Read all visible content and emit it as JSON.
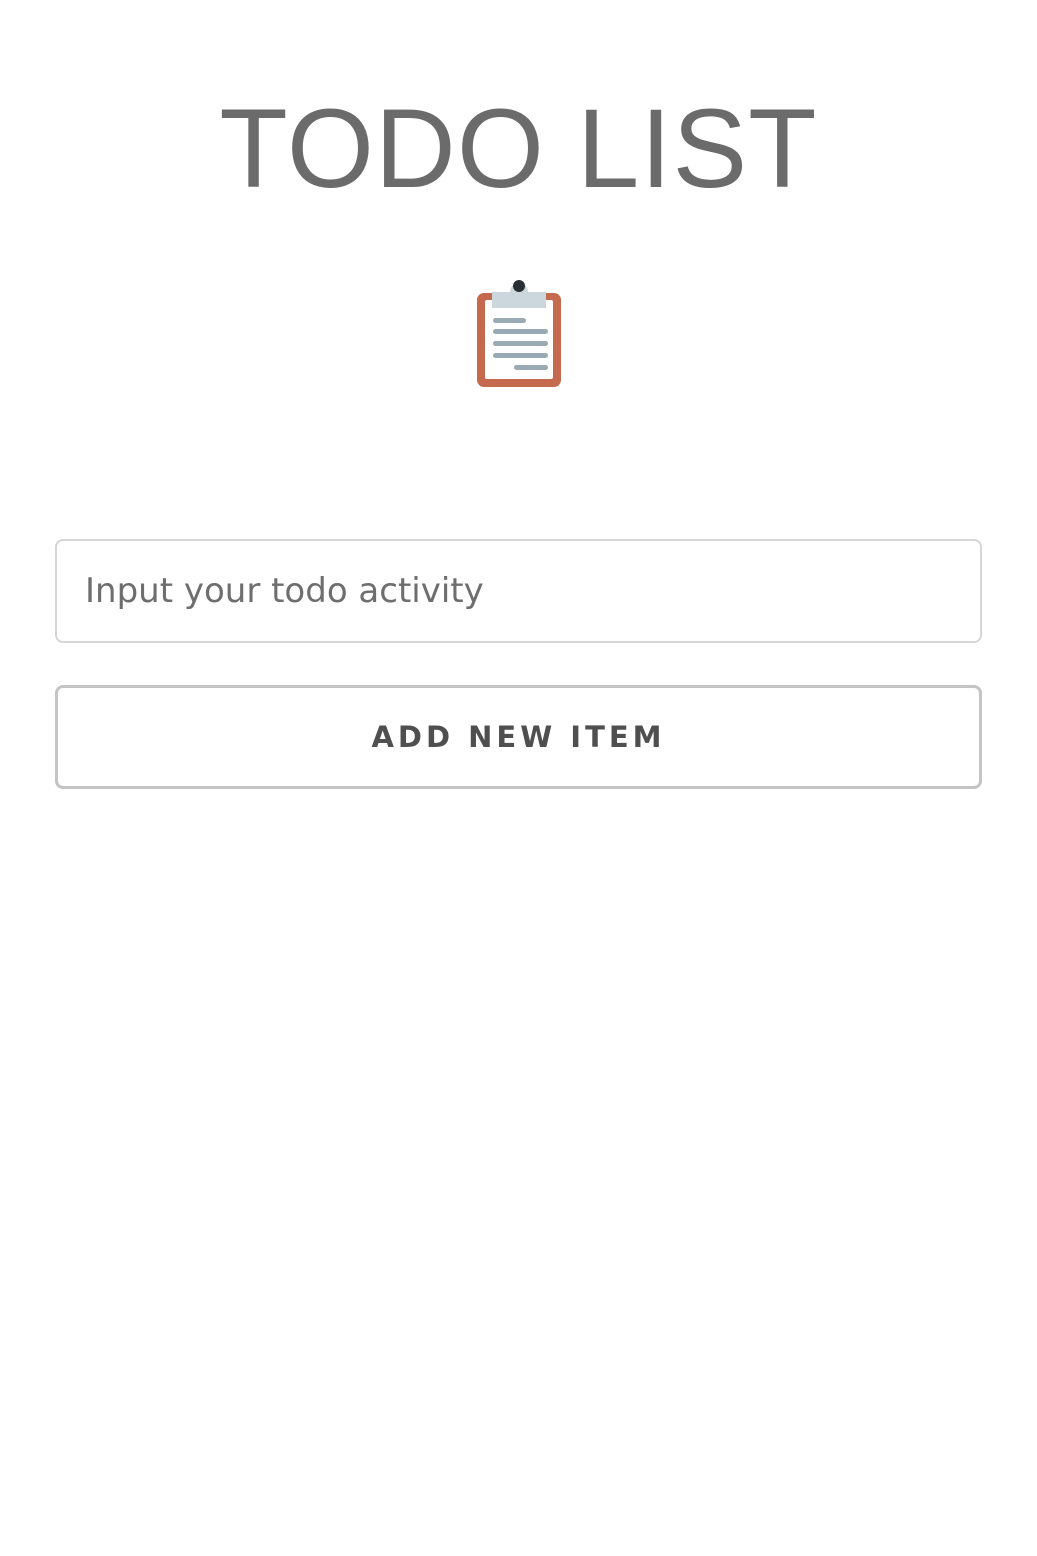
{
  "header": {
    "title": "TODO LIST",
    "icon": "clipboard-icon"
  },
  "form": {
    "input_placeholder": "Input your todo activity",
    "input_value": "",
    "add_button_label": "ADD NEW ITEM"
  },
  "todo_items": [],
  "colors": {
    "title": "#6b6b6b",
    "clipboard_board": "#c5694f",
    "clipboard_clip": "#ccd6dd",
    "clipboard_lines": "#99aab5",
    "input_border": "#d6d6d6",
    "button_border": "#c4c4c4",
    "button_text": "#4f4f4f"
  }
}
